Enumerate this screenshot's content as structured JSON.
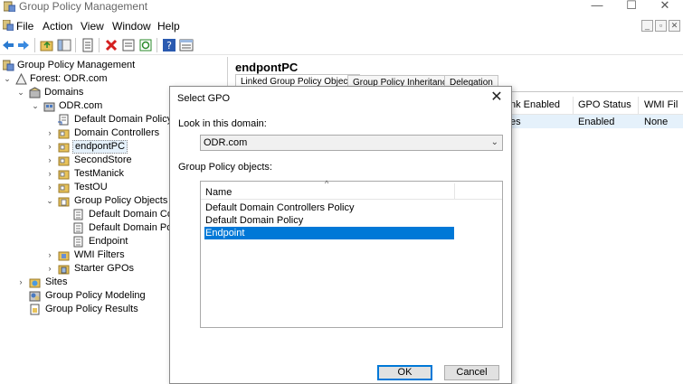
{
  "window": {
    "title": "Group Policy Management",
    "minimize": "—",
    "maximize": "☐",
    "close": "✕"
  },
  "menu": {
    "items": [
      "File",
      "Action",
      "View",
      "Window",
      "Help"
    ],
    "mdi_minimize": "_",
    "mdi_restore": "▫",
    "mdi_close": "✕"
  },
  "tree": {
    "root": "Group Policy Management",
    "forest": "Forest: ODR.com",
    "domains": "Domains",
    "domain": "ODR.com",
    "items": [
      "Default Domain Policy",
      "Domain Controllers",
      "endpontPC",
      "SecondStore",
      "TestManick",
      "TestOU",
      "Group Policy Objects"
    ],
    "gpos": [
      "Default Domain Con",
      "Default Domain Polic",
      "Endpoint"
    ],
    "wmi": "WMI Filters",
    "starter": "Starter GPOs",
    "sites": "Sites",
    "modeling": "Group Policy Modeling",
    "results": "Group Policy Results",
    "selected": "endpontPC"
  },
  "right": {
    "heading": "endpontPC",
    "tabs": [
      "Linked Group Policy Objects",
      "Group Policy Inheritance",
      "Delegation"
    ],
    "columns": [
      "nk Enabled",
      "GPO Status",
      "WMI Fil"
    ],
    "row": [
      "es",
      "Enabled",
      "None"
    ]
  },
  "dialog": {
    "title": "Select GPO",
    "close": "✕",
    "look_label": "Look in this domain:",
    "domain_value": "ODR.com",
    "objects_label": "Group Policy objects:",
    "name_header": "Name",
    "items": [
      "Default Domain Controllers Policy",
      "Default Domain Policy",
      "Endpoint"
    ],
    "selected_item": "Endpoint",
    "ok": "OK",
    "cancel": "Cancel"
  },
  "colors": {
    "selection": "#0078d7",
    "tree_selection": "#e5f1fb"
  }
}
